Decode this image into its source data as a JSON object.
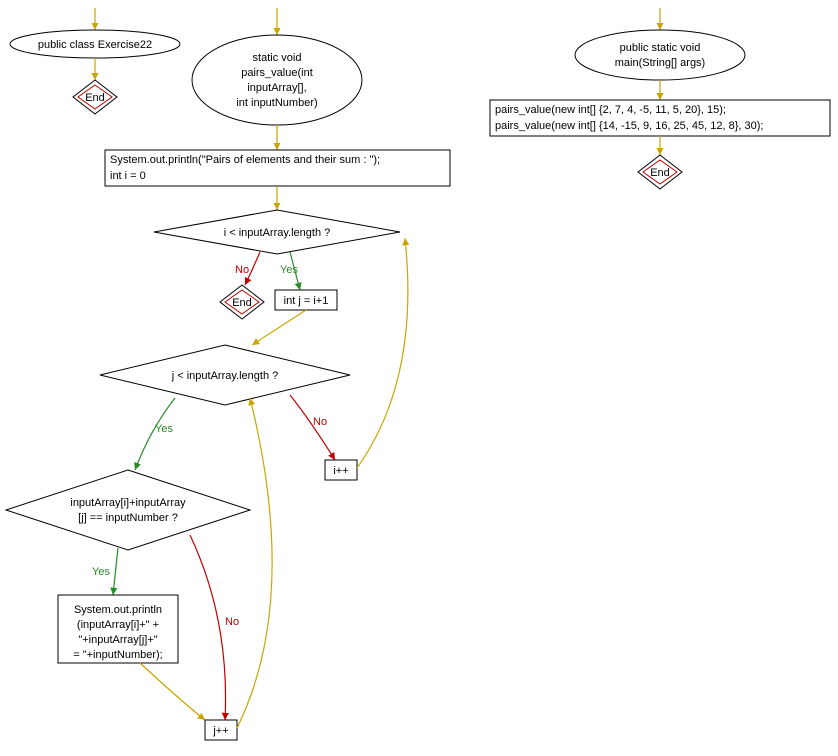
{
  "nodes": {
    "class_def": "public class Exercise22",
    "end1": "End",
    "method_def_l1": "static void",
    "method_def_l2": "pairs_value(int",
    "method_def_l3": "inputArray[],",
    "method_def_l4": "int inputNumber)",
    "main_def_l1": "public static void",
    "main_def_l2": "main(String[] args)",
    "main_body_l1": "pairs_value(new int[] {2, 7, 4, -5, 11, 5, 20}, 15);",
    "main_body_l2": "pairs_value(new int[] {14, -15, 9, 16, 25, 45, 12, 8}, 30);",
    "end_main": "End",
    "stmt1_l1": "System.out.println(\"Pairs of elements and their sum : \");",
    "stmt1_l2": "int i = 0",
    "cond1": "i < inputArray.length ?",
    "end2": "End",
    "stmt2": "int j = i+1",
    "cond2": "j < inputArray.length ?",
    "stmt_ipp": "i++",
    "cond3_l1": "inputArray[i]+inputArray",
    "cond3_l2": "[j] == inputNumber ?",
    "stmt3_l1": "System.out.println",
    "stmt3_l2": "(inputArray[i]+\" +",
    "stmt3_l3": "\"+inputArray[j]+\"",
    "stmt3_l4": "= \"+inputNumber);",
    "stmt_jpp": "j++"
  },
  "labels": {
    "yes": "Yes",
    "no": "No"
  },
  "colors": {
    "stroke": "#000000",
    "arrow_default": "#c9a500",
    "arrow_yes": "#2a8a2a",
    "arrow_no": "#c00000",
    "fill": "#ffffff",
    "end_inner": "#c00000"
  }
}
